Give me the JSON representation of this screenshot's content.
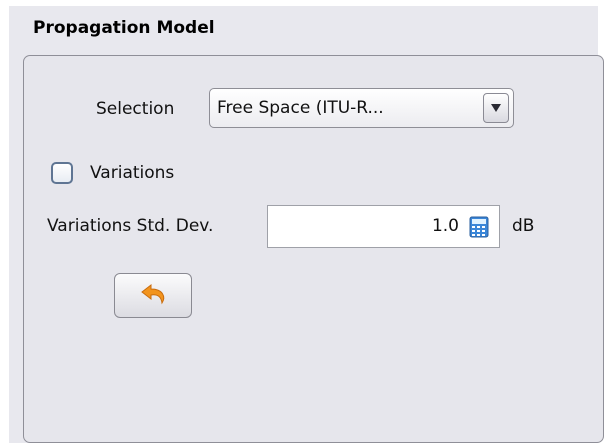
{
  "panel": {
    "title": "Propagation Model"
  },
  "selection": {
    "label": "Selection",
    "value": "Free Space (ITU-R..."
  },
  "variations": {
    "label": "Variations",
    "checked": false
  },
  "std_dev": {
    "label": "Variations Std. Dev.",
    "value": "1.0",
    "unit": "dB"
  },
  "icons": {
    "dropdown": "dropdown-arrow-icon",
    "calculator": "calculator-icon",
    "undo": "undo-arrow-icon"
  },
  "colors": {
    "undo_arrow": "#f2941e",
    "checkbox_border": "#5f7593",
    "calculator": "#3a86d8"
  }
}
